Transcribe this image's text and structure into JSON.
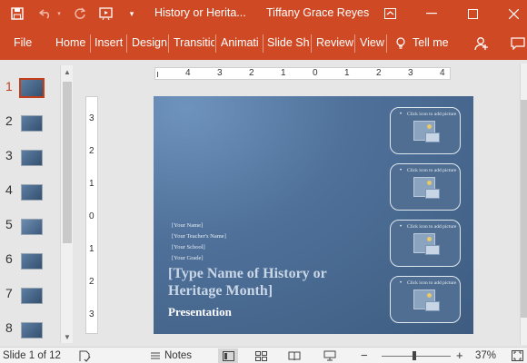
{
  "titlebar": {
    "doc_title": "History or Herita...",
    "user": "Tiffany Grace Reyes"
  },
  "ribbon": {
    "tabs": [
      "File",
      "Home",
      "Insert",
      "Design",
      "Transitic",
      "Animati",
      "Slide Sh",
      "Review",
      "View"
    ],
    "tell_me": "Tell me"
  },
  "thumbnails": {
    "numbers": [
      "1",
      "2",
      "3",
      "4",
      "5",
      "6",
      "7",
      "8"
    ],
    "selected": "1"
  },
  "ruler": {
    "h_numbers": [
      "4",
      "3",
      "2",
      "1",
      "0",
      "1",
      "2",
      "3",
      "4"
    ],
    "v_numbers": [
      "3",
      "2",
      "1",
      "0",
      "1",
      "2",
      "3"
    ]
  },
  "slide": {
    "lines": [
      "[Your Name]",
      "[Your Teacher's Name]",
      "[Your School]",
      "[Your Grade]"
    ],
    "title": "[Type Name of History or Heritage Month]",
    "subtitle": "Presentation",
    "picture_placeholder": "Click icon to add picture"
  },
  "statusbar": {
    "slide_info": "Slide 1 of 12",
    "notes": "Notes",
    "zoom": "37%",
    "minus": "−",
    "plus": "+"
  },
  "colors": {
    "accent": "#d04925",
    "selected_thumb": "#c43e1c",
    "slide_bg": "#4f719a"
  }
}
